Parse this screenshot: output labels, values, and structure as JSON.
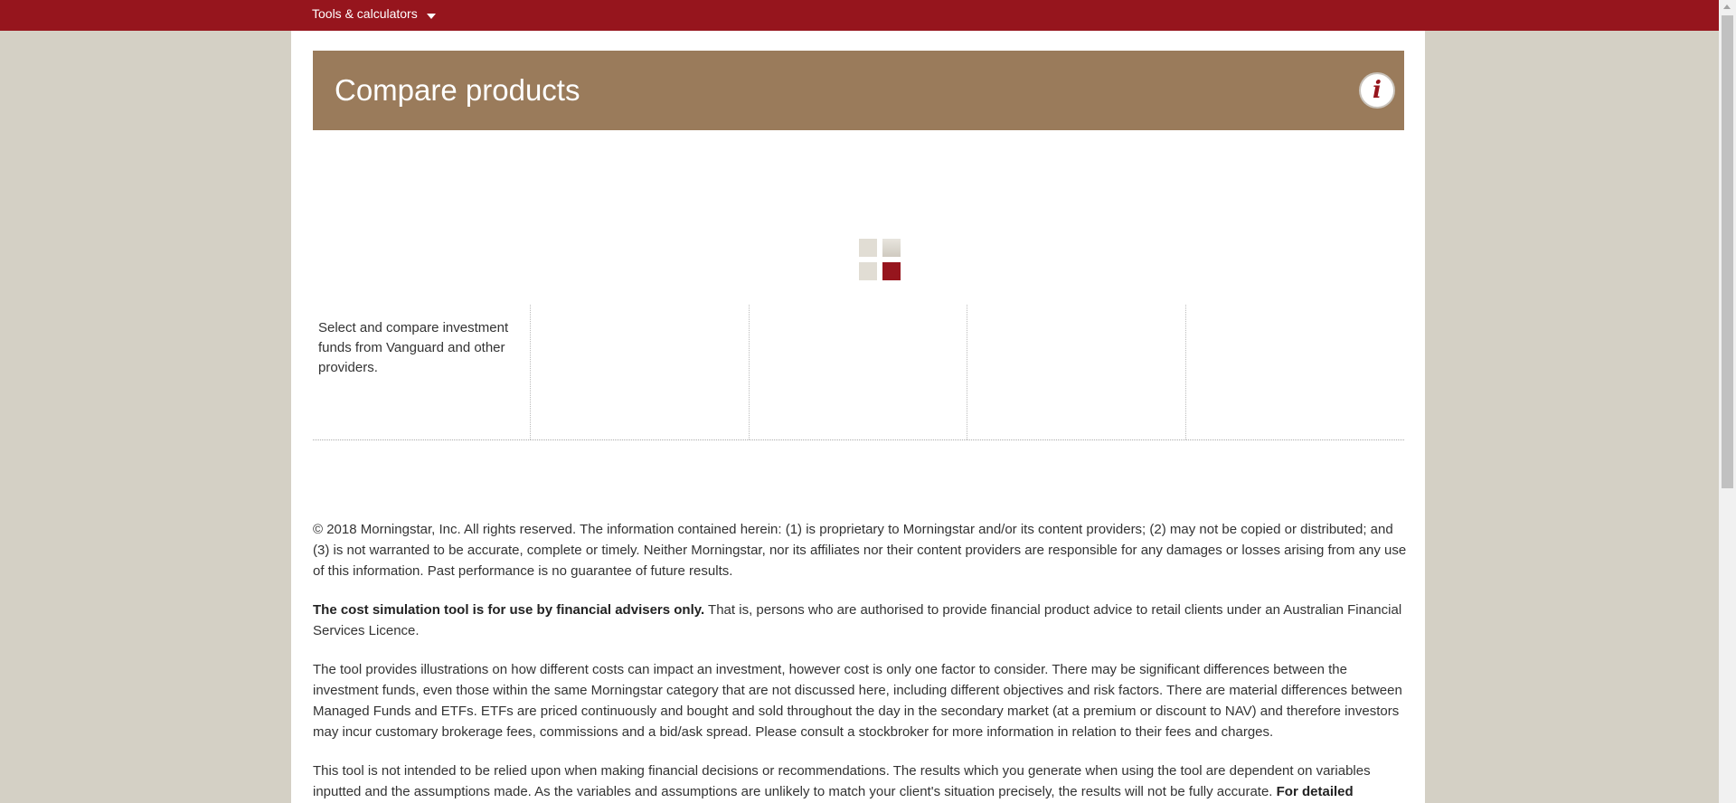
{
  "topbar": {
    "menu_label": "Tools & calculators"
  },
  "hero": {
    "title": "Compare products",
    "info_icon_glyph": "i"
  },
  "compare": {
    "intro": "Select and compare investment funds from Vanguard and other providers."
  },
  "disclaimer": {
    "p1": "© 2018 Morningstar, Inc. All rights reserved. The information contained herein: (1) is proprietary to Morningstar and/or its content providers; (2) may not be copied or distributed; and (3) is not warranted to be accurate, complete or timely. Neither Morningstar, nor its affiliates nor their content providers are responsible for any damages or losses arising from any use of this information. Past performance is no guarantee of future results.",
    "p2_bold": "The cost simulation tool is for use by financial advisers only.",
    "p2_rest": " That is, persons who are authorised to provide financial product advice to retail clients under an Australian Financial Services Licence.",
    "p3": "The tool provides illustrations on how different costs can impact an investment, however cost is only one factor to consider. There may be significant differences between the investment funds, even those within the same Morningstar category that are not discussed here, including different objectives and risk factors. There are material differences between Managed Funds and ETFs. ETFs are priced continuously and bought and sold throughout the day in the secondary market (at a premium or discount to NAV) and therefore investors may incur customary brokerage fees, commissions and a bid/ask spread. Please consult a stockbroker for more information in relation to their fees and charges.",
    "p4": "This tool is not intended to be relied upon when making financial decisions or recommendations. The results which you generate when using the tool are dependent on variables inputted and the assumptions made. As the variables and assumptions are unlikely to match your client's situation precisely, the results will not be fully accurate. ",
    "p4_bold": "For detailed"
  },
  "colors": {
    "brand_red": "#96151d",
    "hero_brown": "#9a7b5b",
    "background": "#d4d0c5"
  }
}
